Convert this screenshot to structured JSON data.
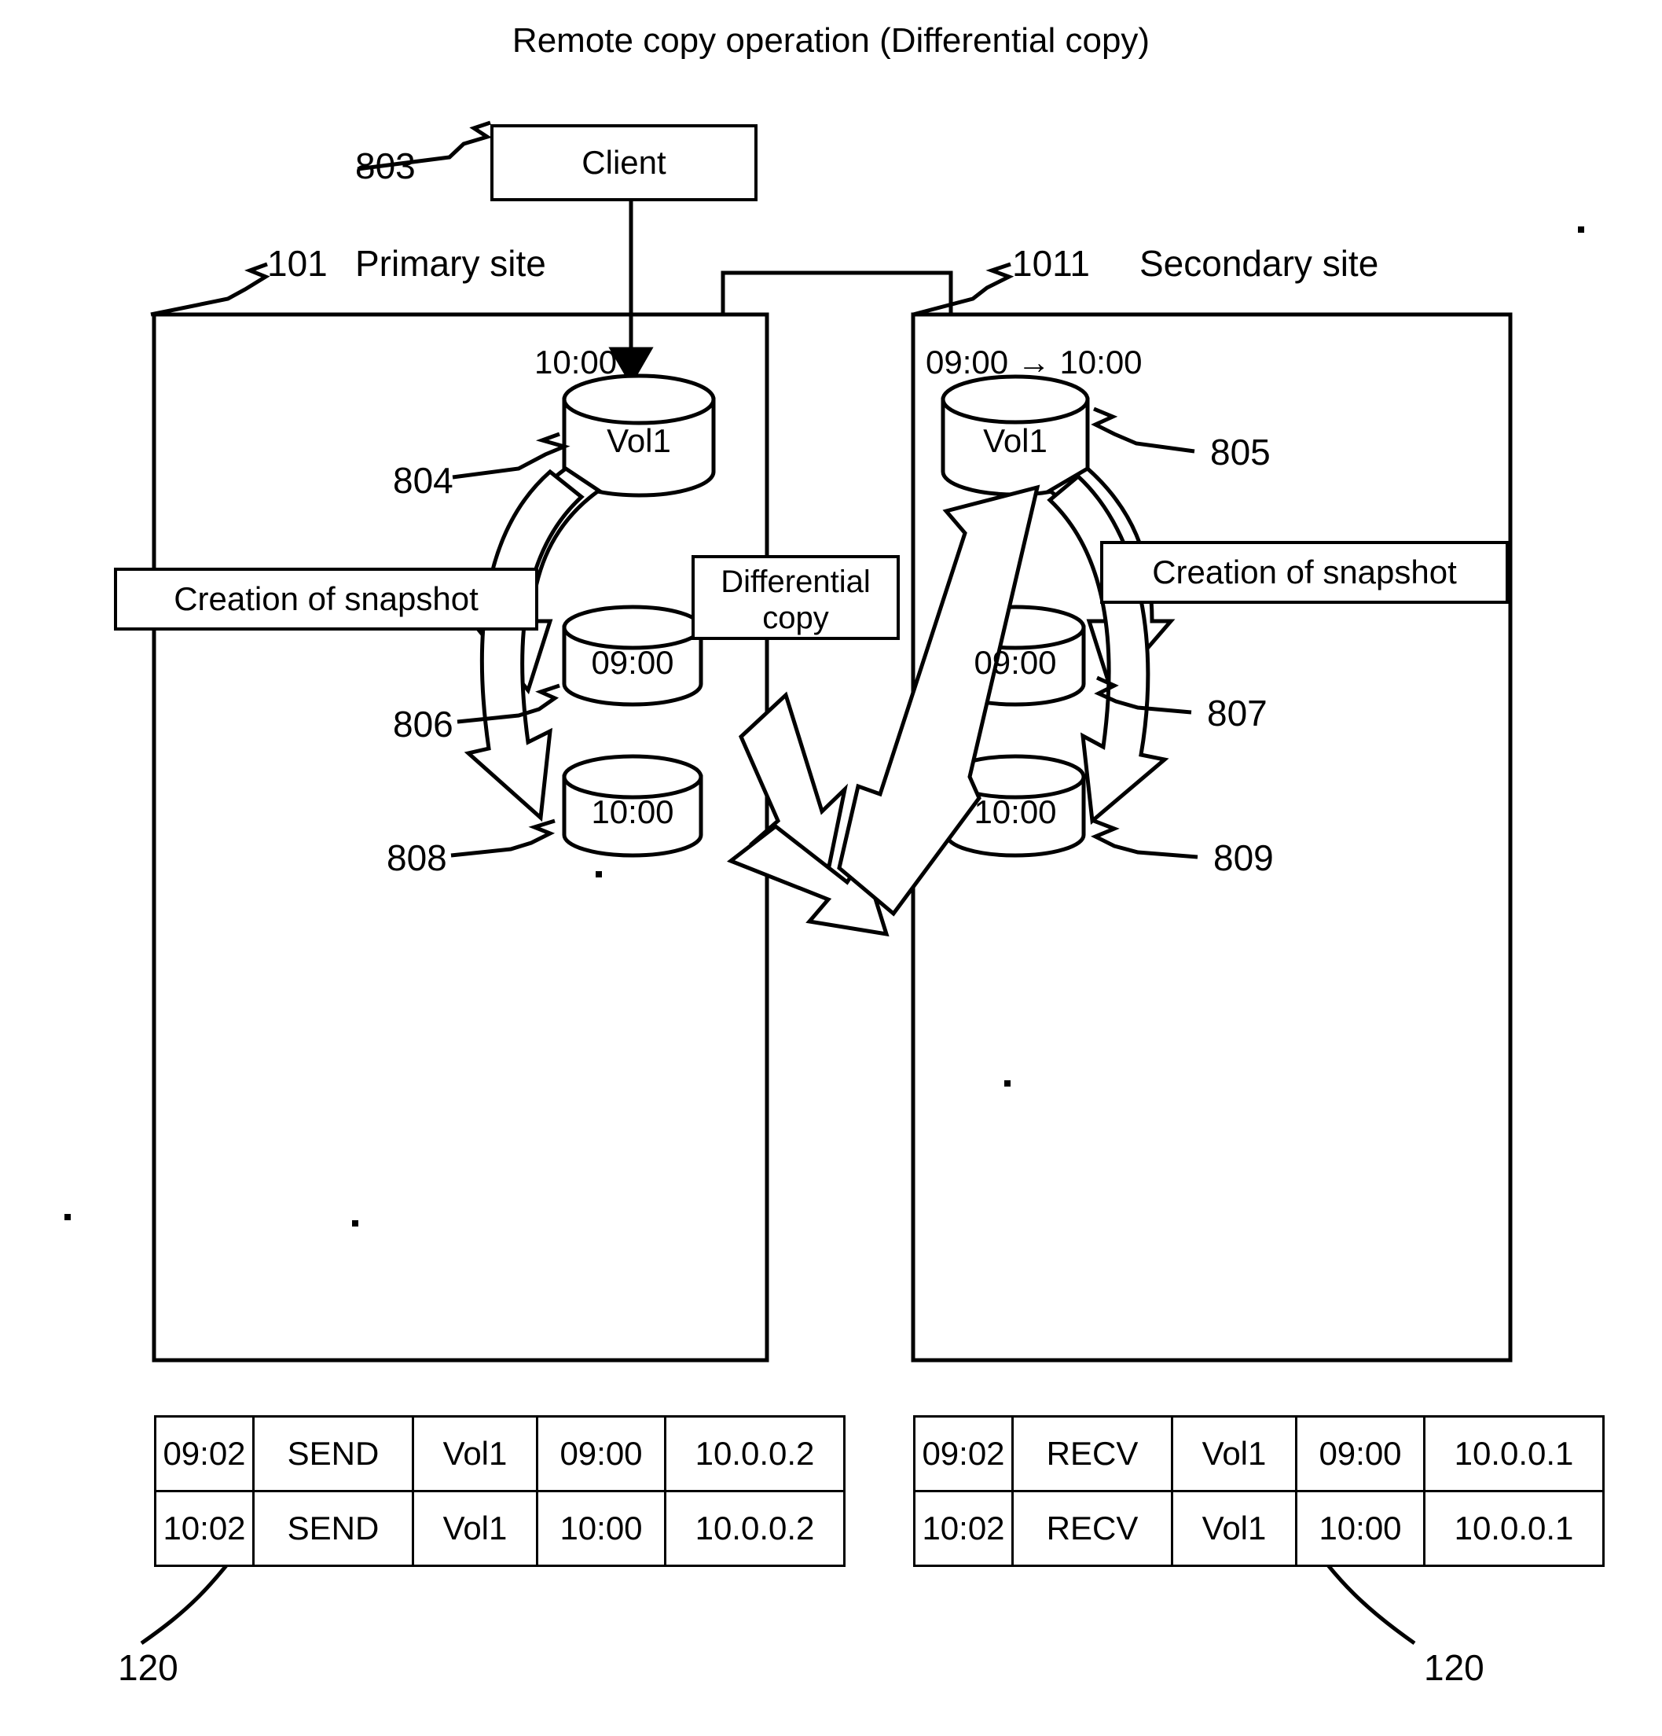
{
  "figure": {
    "title": "Remote copy operation (Differential copy)"
  },
  "client": {
    "label": "Client",
    "ref": "803"
  },
  "primary_site": {
    "ref": "101",
    "name": "Primary site",
    "volume": {
      "name": "Vol1",
      "time_label": "10:00",
      "ref": "804"
    },
    "snapshot_box_label": "Creation of snapshot",
    "snapshots": [
      {
        "time": "09:00",
        "ref": "806"
      },
      {
        "time": "10:00",
        "ref": "808"
      }
    ]
  },
  "secondary_site": {
    "ref": "1011",
    "name": "Secondary site",
    "volume": {
      "name": "Vol1",
      "time_label": "09:00 → 10:00",
      "ref": "805"
    },
    "snapshot_box_label": "Creation of snapshot",
    "snapshots": [
      {
        "time": "09:00",
        "ref": "807"
      },
      {
        "time": "10:00",
        "ref": "809"
      }
    ]
  },
  "differential_copy": {
    "line1": "Differential",
    "line2": "copy"
  },
  "primary_log": {
    "ref": "120",
    "rows": [
      [
        "09:02",
        "SEND",
        "Vol1",
        "09:00",
        "10.0.0.2"
      ],
      [
        "10:02",
        "SEND",
        "Vol1",
        "10:00",
        "10.0.0.2"
      ]
    ]
  },
  "secondary_log": {
    "ref": "120",
    "rows": [
      [
        "09:02",
        "RECV",
        "Vol1",
        "09:00",
        "10.0.0.1"
      ],
      [
        "10:02",
        "RECV",
        "Vol1",
        "10:00",
        "10.0.0.1"
      ]
    ]
  }
}
